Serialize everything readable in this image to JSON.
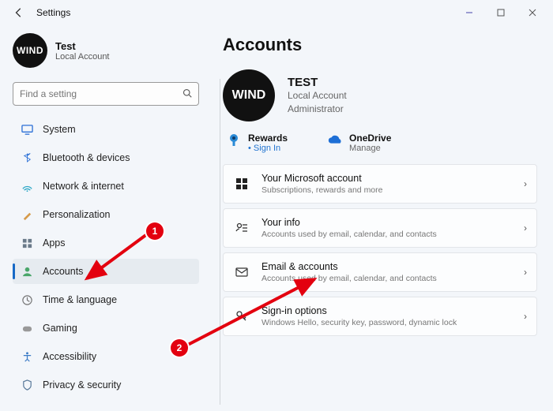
{
  "window": {
    "title": "Settings"
  },
  "profile": {
    "avatar_text": "WIND",
    "name": "Test",
    "subtitle": "Local Account"
  },
  "search": {
    "placeholder": "Find a setting"
  },
  "nav": {
    "system": "System",
    "bluetooth": "Bluetooth & devices",
    "network": "Network & internet",
    "personalization": "Personalization",
    "apps": "Apps",
    "accounts": "Accounts",
    "time": "Time & language",
    "gaming": "Gaming",
    "accessibility": "Accessibility",
    "privacy": "Privacy & security"
  },
  "page": {
    "heading": "Accounts",
    "account": {
      "avatar_text": "WIND",
      "name": "TEST",
      "line1": "Local Account",
      "line2": "Administrator"
    },
    "quick": {
      "rewards": {
        "title": "Rewards",
        "action": "Sign In",
        "bullet": "•"
      },
      "onedrive": {
        "title": "OneDrive",
        "action": "Manage"
      }
    },
    "cards": {
      "ms": {
        "title": "Your Microsoft account",
        "sub": "Subscriptions, rewards and more"
      },
      "info": {
        "title": "Your info",
        "sub": "Accounts used by email, calendar, and contacts"
      },
      "email": {
        "title": "Email & accounts",
        "sub": "Accounts used by email, calendar, and contacts"
      },
      "signin": {
        "title": "Sign-in options",
        "sub": "Windows Hello, security key, password, dynamic lock"
      }
    }
  },
  "annotations": {
    "badge1": "1",
    "badge2": "2"
  }
}
